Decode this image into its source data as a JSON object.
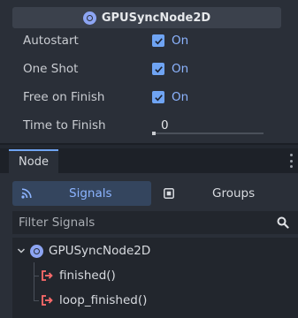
{
  "inspector": {
    "class_name": "GPUSyncNode2D",
    "properties": [
      {
        "label": "Autostart",
        "value": "On",
        "checked": true
      },
      {
        "label": "One Shot",
        "value": "On",
        "checked": true
      },
      {
        "label": "Free on Finish",
        "value": "On",
        "checked": true
      },
      {
        "label": "Time to Finish",
        "value": "0"
      }
    ]
  },
  "dock": {
    "tab_label": "Node",
    "modes": {
      "signals": "Signals",
      "groups": "Groups"
    },
    "filter_placeholder": "Filter Signals",
    "tree": {
      "root": "GPUSyncNode2D",
      "signals": [
        "finished()",
        "loop_finished()"
      ]
    }
  },
  "colors": {
    "accent": "#6fa4f3",
    "node_icon": "#8da5f3",
    "signal_icon": "#ff6b6b",
    "checked_text": "#8cb4ff"
  }
}
